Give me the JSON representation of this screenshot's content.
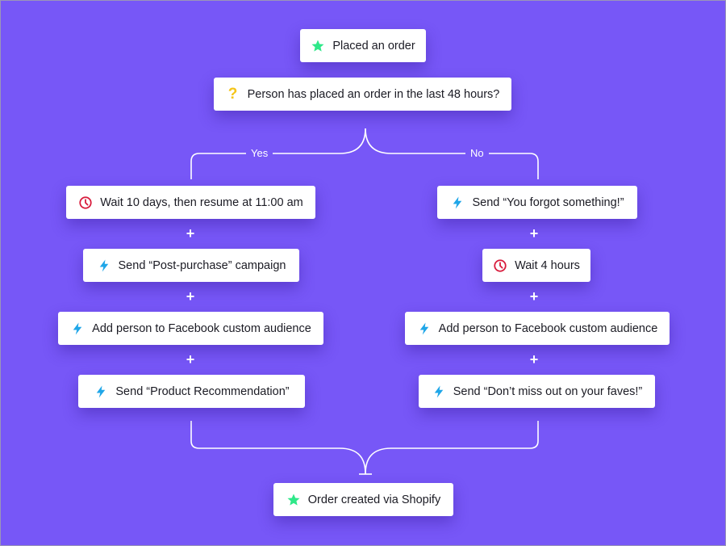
{
  "flow": {
    "trigger": {
      "label": "Placed an order",
      "icon": "star-icon"
    },
    "condition": {
      "label": "Person has placed an order in the last 48 hours?",
      "icon": "question-icon"
    },
    "branches": {
      "yes": {
        "label": "Yes",
        "steps": [
          {
            "label": "Wait 10 days, then resume at 11:00 am",
            "icon": "clock-icon"
          },
          {
            "label": "Send “Post-purchase” campaign",
            "icon": "lightning-icon"
          },
          {
            "label": "Add person to Facebook custom audience",
            "icon": "lightning-icon"
          },
          {
            "label": "Send “Product Recommendation”",
            "icon": "lightning-icon"
          }
        ]
      },
      "no": {
        "label": "No",
        "steps": [
          {
            "label": "Send “You forgot something!”",
            "icon": "lightning-icon"
          },
          {
            "label": "Wait 4 hours",
            "icon": "clock-icon"
          },
          {
            "label": "Add person to Facebook custom audience",
            "icon": "lightning-icon"
          },
          {
            "label": "Send “Don’t miss out on your faves!”",
            "icon": "lightning-icon"
          }
        ]
      }
    },
    "end": {
      "label": "Order created via Shopify",
      "icon": "star-icon"
    },
    "plus_symbol": "+"
  },
  "colors": {
    "background": "#7757f7",
    "star": "#2ee889",
    "question": "#f5c518",
    "clock": "#d81b3c",
    "lightning": "#1fa6e8",
    "connector": "#ffffff"
  }
}
